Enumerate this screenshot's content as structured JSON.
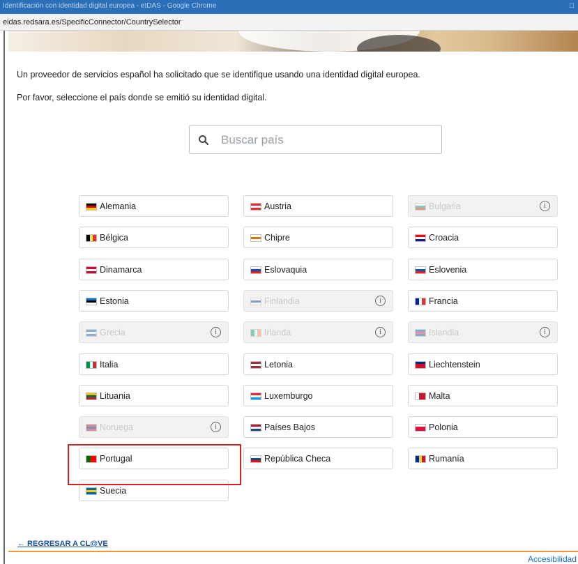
{
  "browser": {
    "title": "Identificación con identidad digital europea - eIDAS - Google Chrome",
    "url": "eidas.redsara.es/SpecificConnector/CountrySelector"
  },
  "intro": {
    "line1": "Un proveedor de servicios español ha solicitado que se identifique usando una identidad digital europea.",
    "line2": "Por favor, seleccione el país donde se emitió su identidad digital."
  },
  "search": {
    "placeholder": "Buscar país",
    "icon": "search-icon"
  },
  "info_icon_glyph": "ⓘ",
  "countries": [
    {
      "name": "Alemania",
      "enabled": true,
      "flag": [
        "#000000",
        "#dd0000",
        "#ffce00"
      ]
    },
    {
      "name": "Austria",
      "enabled": true,
      "flag": [
        "#ed2939",
        "#ffffff",
        "#ed2939"
      ]
    },
    {
      "name": "Bulgaria",
      "enabled": false,
      "flag": [
        "#ffffff",
        "#00966e",
        "#d62612"
      ]
    },
    {
      "name": "Bélgica",
      "enabled": true,
      "flag_vertical": true,
      "flag": [
        "#000000",
        "#fae042",
        "#ed2939"
      ]
    },
    {
      "name": "Chipre",
      "enabled": true,
      "flag": [
        "#ffffff",
        "#d57800",
        "#ffffff"
      ]
    },
    {
      "name": "Croacia",
      "enabled": true,
      "flag": [
        "#ff0000",
        "#ffffff",
        "#171796"
      ]
    },
    {
      "name": "Dinamarca",
      "enabled": true,
      "flag": [
        "#c60c30",
        "#ffffff",
        "#c60c30"
      ]
    },
    {
      "name": "Eslovaquia",
      "enabled": true,
      "flag": [
        "#ffffff",
        "#0b4ea2",
        "#ee1c25"
      ]
    },
    {
      "name": "Eslovenia",
      "enabled": true,
      "flag": [
        "#ffffff",
        "#005da4",
        "#ed1c24"
      ]
    },
    {
      "name": "Estonia",
      "enabled": true,
      "flag": [
        "#0072ce",
        "#000000",
        "#ffffff"
      ]
    },
    {
      "name": "Finlandia",
      "enabled": false,
      "flag": [
        "#ffffff",
        "#003580",
        "#ffffff"
      ]
    },
    {
      "name": "Francia",
      "enabled": true,
      "flag_vertical": true,
      "flag": [
        "#002395",
        "#ffffff",
        "#ed2939"
      ]
    },
    {
      "name": "Grecia",
      "enabled": false,
      "flag": [
        "#0d5eaf",
        "#ffffff",
        "#0d5eaf"
      ]
    },
    {
      "name": "Irlanda",
      "enabled": false,
      "flag_vertical": true,
      "flag": [
        "#169b62",
        "#ffffff",
        "#ff883e"
      ]
    },
    {
      "name": "Islandia",
      "enabled": false,
      "flag": [
        "#02529c",
        "#dc1e35",
        "#02529c"
      ]
    },
    {
      "name": "Italia",
      "enabled": true,
      "flag_vertical": true,
      "flag": [
        "#009246",
        "#ffffff",
        "#ce2b37"
      ]
    },
    {
      "name": "Letonia",
      "enabled": true,
      "flag": [
        "#9e3039",
        "#ffffff",
        "#9e3039"
      ]
    },
    {
      "name": "Liechtenstein",
      "enabled": true,
      "flag": [
        "#002b7f",
        "#ce1126",
        "#ce1126"
      ]
    },
    {
      "name": "Lituania",
      "enabled": true,
      "flag": [
        "#fdb913",
        "#006a44",
        "#c1272d"
      ]
    },
    {
      "name": "Luxemburgo",
      "enabled": true,
      "flag": [
        "#ed2939",
        "#ffffff",
        "#00a1de"
      ]
    },
    {
      "name": "Malta",
      "enabled": true,
      "flag_vertical": true,
      "flag": [
        "#ffffff",
        "#cf142b",
        "#cf142b"
      ]
    },
    {
      "name": "Noruega",
      "enabled": false,
      "flag": [
        "#ba0c2f",
        "#00205b",
        "#ba0c2f"
      ]
    },
    {
      "name": "Países Bajos",
      "enabled": true,
      "flag": [
        "#ae1c28",
        "#ffffff",
        "#21468b"
      ]
    },
    {
      "name": "Polonia",
      "enabled": true,
      "flag": [
        "#ffffff",
        "#dc143c",
        "#dc143c"
      ]
    },
    {
      "name": "Portugal",
      "enabled": true,
      "flag_vertical": true,
      "flag": [
        "#006600",
        "#ff0000",
        "#ff0000"
      ]
    },
    {
      "name": "República Checa",
      "enabled": true,
      "flag": [
        "#ffffff",
        "#11457e",
        "#d7141a"
      ]
    },
    {
      "name": "Rumanía",
      "enabled": true,
      "flag_vertical": true,
      "flag": [
        "#002b7f",
        "#fcd116",
        "#ce1126"
      ]
    },
    {
      "name": "Suecia",
      "enabled": true,
      "flag": [
        "#006aa7",
        "#fecc00",
        "#006aa7"
      ]
    }
  ],
  "highlighted_country": "Portugal",
  "back_link": "← REGRESAR A CL@VE",
  "accessibility_link": "Accesibilidad"
}
